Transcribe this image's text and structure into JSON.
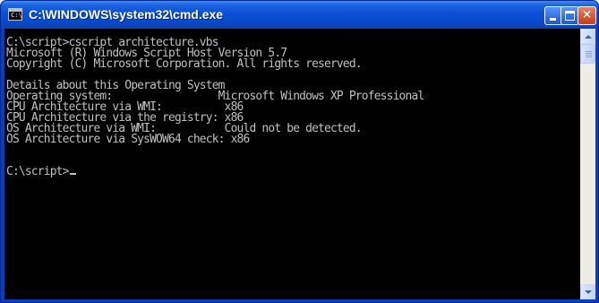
{
  "window": {
    "title": "C:\\WINDOWS\\system32\\cmd.exe",
    "icon_text": "C:\\",
    "buttons": {
      "minimize": "minimize",
      "maximize": "maximize",
      "close": "✕"
    }
  },
  "console": {
    "lines": [
      "C:\\script>cscript architecture.vbs",
      "Microsoft (R) Windows Script Host Version 5.7",
      "Copyright (C) Microsoft Corporation. All rights reserved.",
      "",
      "Details about this Operating System",
      "Operating system:                 Microsoft Windows XP Professional",
      "CPU Architecture via WMI:          x86",
      "CPU Architecture via the registry: x86",
      "OS Architecture via WMI:           Could not be detected.",
      "OS Architecture via SysWOW64 check: x86",
      "",
      "",
      "C:\\script>"
    ]
  },
  "colors": {
    "console_bg": "#000000",
    "console_fg": "#c0c0c0",
    "titlebar": "#0a4fd6"
  }
}
